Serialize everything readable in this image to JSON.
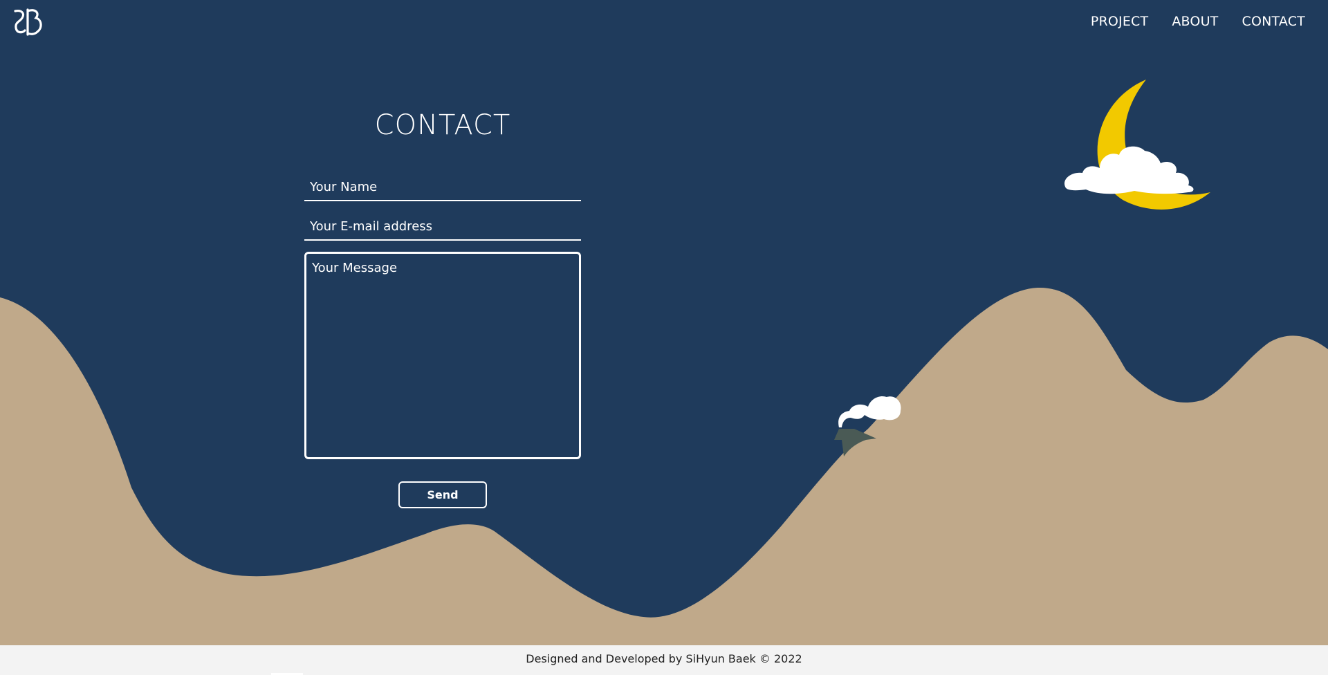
{
  "header": {
    "logo_icon": "sh-monogram-logo-icon",
    "nav": [
      {
        "label": "PROJECT"
      },
      {
        "label": "ABOUT"
      },
      {
        "label": "CONTACT"
      }
    ]
  },
  "contact": {
    "title": "CONTACT",
    "name_placeholder": "Your Name",
    "email_placeholder": "Your E-mail address",
    "message_placeholder": "Your Message",
    "send_label": "Send"
  },
  "scenery": {
    "icons": [
      "crescent-moon-icon",
      "cloud-icon",
      "hut-icon",
      "chimney-smoke-icon",
      "mountains-illustration"
    ]
  },
  "footer": {
    "text": "Designed and Developed by SiHyun Baek © 2022"
  },
  "colors": {
    "sky": "#1f3b5c",
    "mountain": "#c0a98a",
    "moon": "#f2c900",
    "cloud": "#ffffff",
    "hut": "#4a5a55",
    "footer_bg": "#f3f3f3"
  }
}
